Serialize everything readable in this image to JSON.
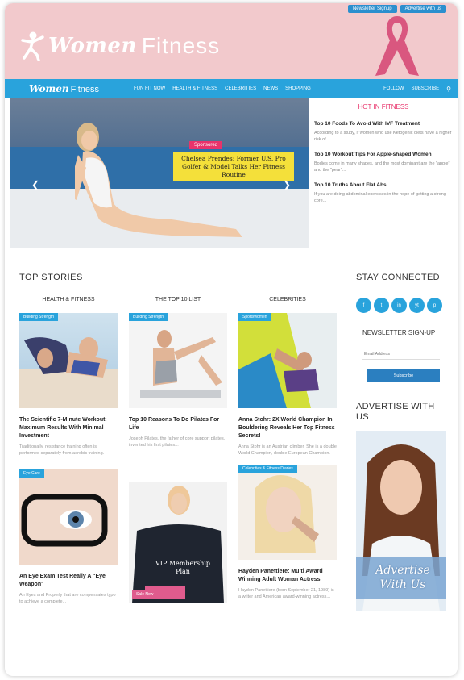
{
  "header": {
    "top_links": [
      "Newsletter Signup",
      "Advertise with us"
    ],
    "logo_women": "Women",
    "logo_fitness": "Fitness"
  },
  "nav": {
    "logo_women": "Women",
    "logo_fitness": "Fitness",
    "items": [
      "Fun Fit Now",
      "Health & Fitness",
      "Celebrities",
      "News",
      "Shopping"
    ],
    "right": [
      "Follow",
      "Subscribe"
    ],
    "search_icon": "search-icon"
  },
  "hero": {
    "tag": "Sponsored",
    "title": "Chelsea Prendes: Former U.S. Pro Golfer & Model Talks Her Fitness Routine"
  },
  "hot": {
    "title": "HOT IN FITNESS",
    "items": [
      {
        "title": "Top 10 Foods To Avoid With IVF Treatment",
        "text": "According to a study, if women who use Ketogenic diets have a higher risk of..."
      },
      {
        "title": "Top 10 Workout Tips For Apple-shaped Women",
        "text": "Bodies come in many shapes, and the most dominant are the \"apple\" and the \"pear\"..."
      },
      {
        "title": "Top 10 Truths About Flat Abs",
        "text": "If you are doing abdominal exercises in the hope of getting a strong core..."
      }
    ]
  },
  "top_stories": {
    "title": "TOP STORIES",
    "columns": [
      {
        "heading": "HEALTH & FITNESS",
        "cards": [
          {
            "badge": "Building Strength",
            "title": "The Scientific 7-Minute Workout: Maximum Results With Minimal Investment",
            "text": "Traditionally, resistance training often is performed separately from aerobic training."
          },
          {
            "badge": "Eye Care",
            "title": "An Eye Exam Test Really A \"Eye Weapon\"",
            "text": "An Eyes and Properly that are compensates typo to achieve a complete..."
          }
        ]
      },
      {
        "heading": "THE TOP 10 LIST",
        "cards": [
          {
            "badge": "Building Strength",
            "title": "Top 10 Reasons To Do Pilates For Life",
            "text": "Joseph Pilates, the father of core support pilates, invented his first pilates..."
          },
          {
            "badge": "Sale Now",
            "overlay": "VIP Membership Plan",
            "title": "",
            "text": ""
          }
        ]
      },
      {
        "heading": "CELEBRITIES",
        "cards": [
          {
            "badge": "Sportswomen",
            "title": "Anna Stohr: 2X World Champion In Bouldering Reveals Her Top Fitness Secrets!",
            "text": "Anna Stohr is an Austrian climber. She is a double World Champion, double European Champion."
          },
          {
            "badge": "Celebrities & Fitness Diaries",
            "title": "Hayden Panettiere: Multi Award Winning Adult Woman Actress",
            "text": "Hayden Panettiere (born September 21, 1989) is a writer and American award-winning actress..."
          }
        ]
      }
    ]
  },
  "sidebar": {
    "stay_connected": "STAY CONNECTED",
    "social": [
      "f",
      "t",
      "in",
      "yt",
      "p"
    ],
    "newsletter_title": "NEWSLETTER SIGN-UP",
    "email_placeholder": "Email Address",
    "subscribe_label": "Subscribe",
    "advertise_title": "ADVERTISE WITH US",
    "advert_text": "Advertise With Us"
  },
  "colors": {
    "banner": "#f2c9cc",
    "nav": "#29a3dc",
    "accent_pink": "#e8336b",
    "button": "#2b7fc0"
  }
}
